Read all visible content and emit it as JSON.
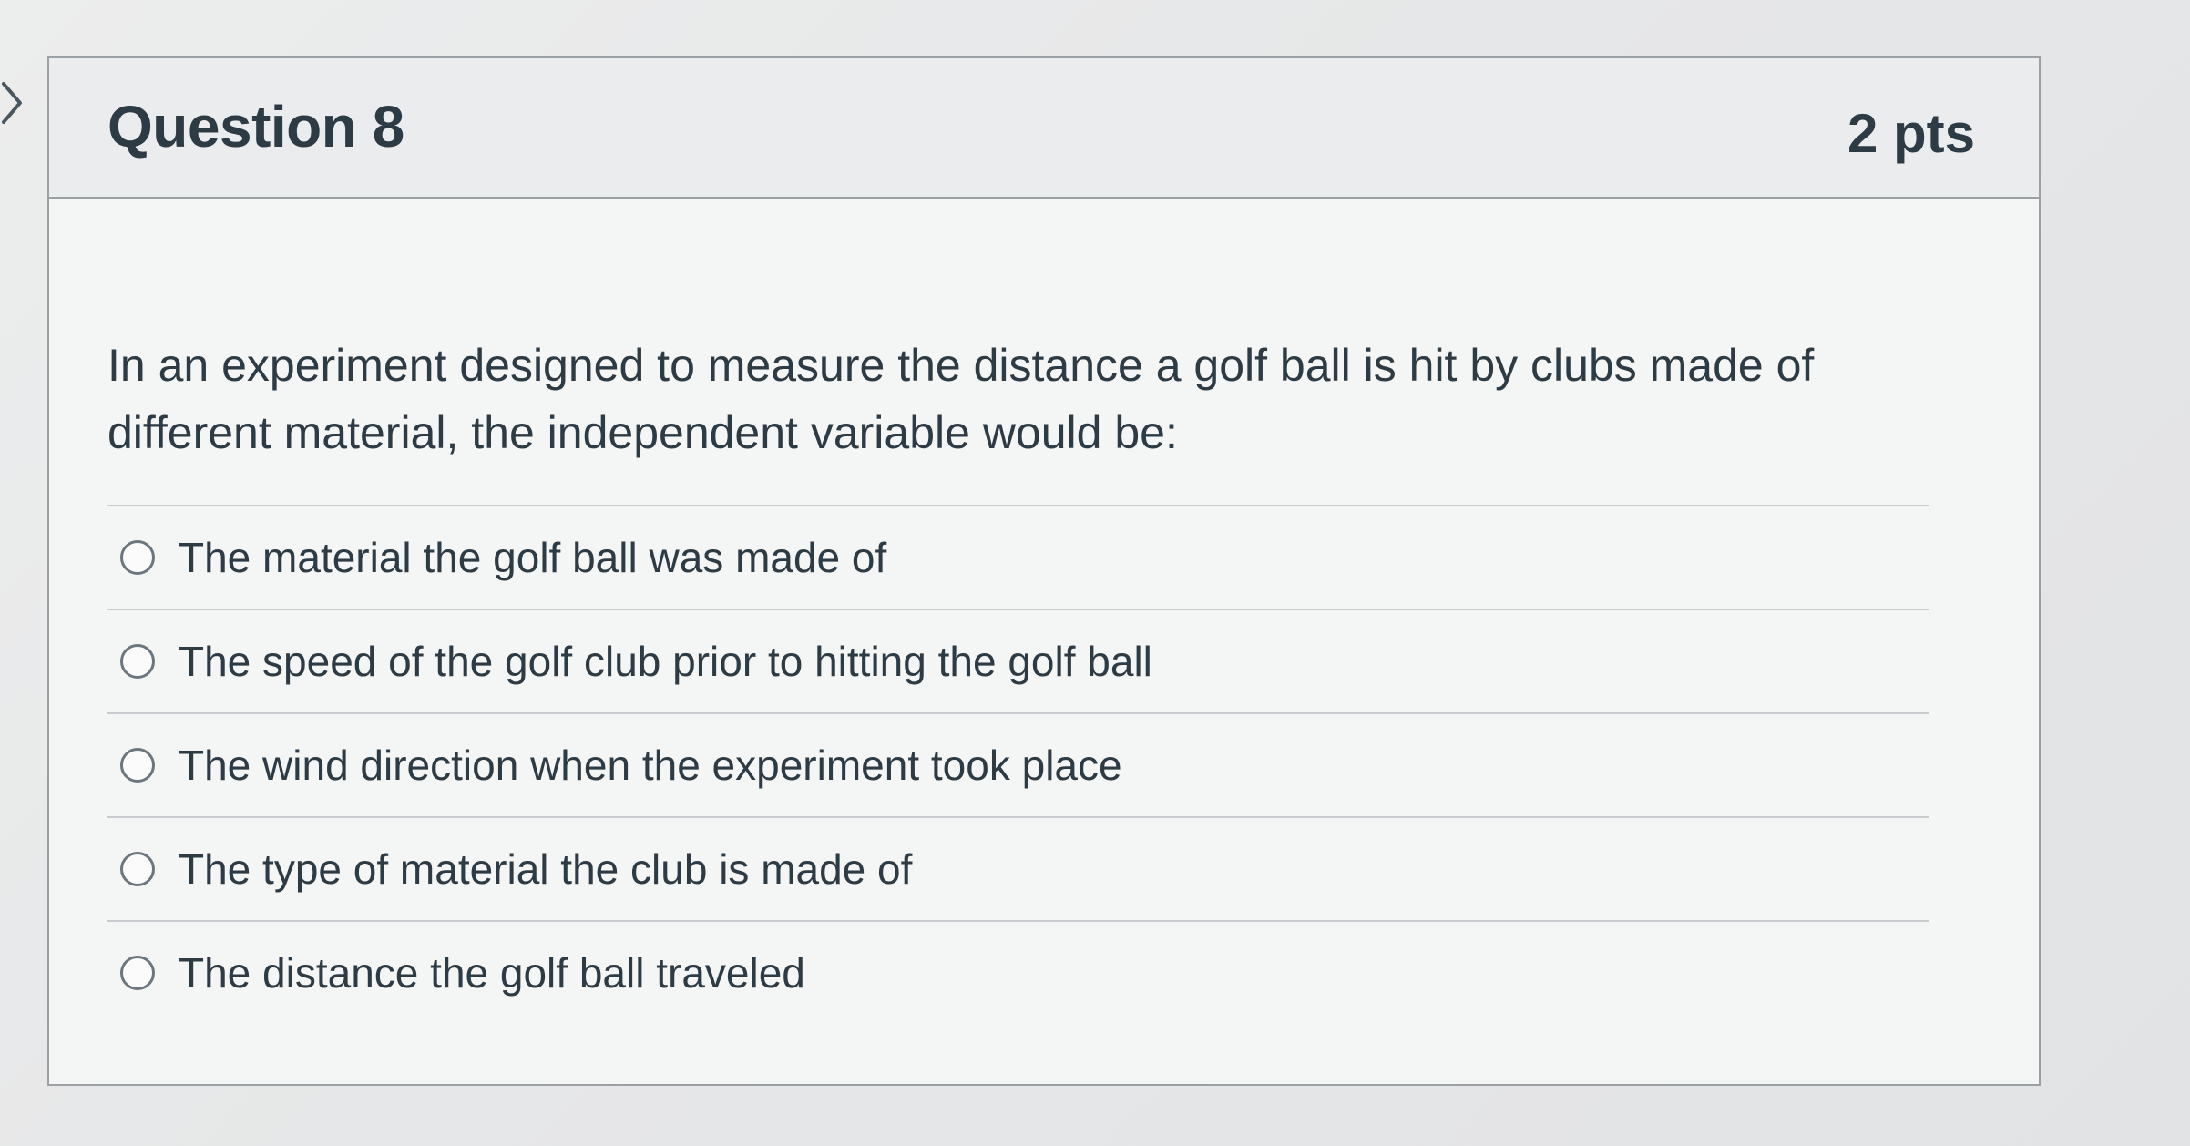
{
  "question": {
    "title": "Question 8",
    "points": "2 pts",
    "text": "In an experiment designed to measure the distance a golf ball is hit by clubs made of different material, the independent variable would be:"
  },
  "answers": [
    {
      "label": "The material the golf ball was made of",
      "selected": false
    },
    {
      "label": "The speed of the golf club prior to hitting the golf ball",
      "selected": false
    },
    {
      "label": "The wind direction when the experiment took place",
      "selected": false
    },
    {
      "label": "The type of material the club is made of",
      "selected": false
    },
    {
      "label": "The distance the golf ball traveled",
      "selected": false
    }
  ],
  "icons": {
    "nav": "chevron-right-icon",
    "option": "radio-button-icon"
  },
  "colors": {
    "text": "#2d3b45",
    "border": "#9aa0a4",
    "divider": "#c7cbce",
    "radio": "#6b7780"
  }
}
